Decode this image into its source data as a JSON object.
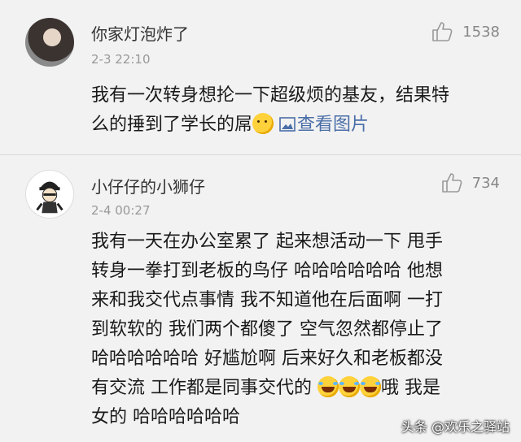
{
  "comments": [
    {
      "username": "你家灯泡炸了",
      "timestamp": "2-3 22:10",
      "likes": "1538",
      "body_lines": [
        "我有一次转身想抡一下超级烦的基友，结果特",
        "么的捶到了学长的屌"
      ],
      "view_image_label": "查看图片"
    },
    {
      "username": "小仔仔的小狮仔",
      "timestamp": "2-4 00:27",
      "likes": "734",
      "body_lines": [
        "我有一天在办公室累了 起来想活动一下 甩手",
        "转身一拳打到老板的鸟仔 哈哈哈哈哈哈 他想",
        "来和我交代点事情 我不知道他在后面啊 一打",
        "到软软的 我们两个都傻了 空气忽然都停止了",
        "哈哈哈哈哈哈 好尴尬啊 后来好久和老板都没",
        "有交流 工作都是同事交代的",
        "哦 我是",
        "女的 哈哈哈哈哈哈"
      ]
    }
  ],
  "watermark": "头条 @欢乐之驿站",
  "icons": {
    "like": "thumbs-up-icon",
    "image": "image-icon",
    "emoji_think": "thinking-emoji-icon",
    "emoji_laugh": "laughing-tears-emoji-icon"
  },
  "colors": {
    "background": "#f2f2f2",
    "link": "#4a6ea8",
    "meta": "#999999"
  }
}
